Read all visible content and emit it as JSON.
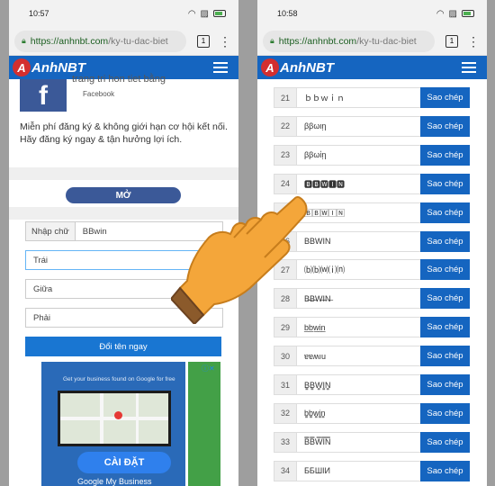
{
  "left": {
    "time": "10:57",
    "url_host": "https://anhnbt.com",
    "url_path": "/ky-tu-dac-biet",
    "tab_count": "1",
    "logo": "AnhNBT",
    "logo_letter": "A",
    "fb_title": "trang tri hon tiet bằng",
    "fb_subtitle": "Facebook",
    "promo_text": "Miễn phí đăng ký & không giới hạn cơ hội kết nối. Hãy đăng ký ngay & tận hưởng lợi ích.",
    "open_button": "MỞ",
    "input_label": "Nhập chữ",
    "input_value": "BBwin",
    "align_left": "Trái",
    "align_center": "Giữa",
    "align_right": "Phải",
    "rename_button": "Đổi tên ngay",
    "ad_headline": "Get your business found on Google for free",
    "ad_install": "CÀI ĐẶT",
    "ad_footer": "Google My Business"
  },
  "right": {
    "time": "10:58",
    "url_host": "https://anhnbt.com",
    "url_path": "/ky-tu-dac-biet",
    "tab_count": "1",
    "logo": "AnhNBT",
    "logo_letter": "A",
    "copy_label": "Sao chép",
    "rows": [
      {
        "num": "21",
        "text": "ｂｂｗｉｎ"
      },
      {
        "num": "22",
        "text": "ββωιῃ"
      },
      {
        "num": "23",
        "text": "ββωἰῃ"
      },
      {
        "num": "24",
        "text": "🅱🅱🆆🅸🅽"
      },
      {
        "num": "25",
        "text": "🄱🄱🅆🄸🄽"
      },
      {
        "num": "26",
        "text": "BBWIN"
      },
      {
        "num": "27",
        "text": "⒝⒝⒲⒤⒩"
      },
      {
        "num": "28",
        "text": "B̶B̶W̶I̶N̶"
      },
      {
        "num": "29",
        "text": "b̲b̲w̲i̲n̲"
      },
      {
        "num": "30",
        "text": "ɐɐʍıu"
      },
      {
        "num": "31",
        "text": "B̳B̳W̳I̳N̳"
      },
      {
        "num": "32",
        "text": "b̳b̳w̳i̳n̳"
      },
      {
        "num": "33",
        "text": "B̿B̿W̿I̿N̿"
      },
      {
        "num": "34",
        "text": "ББШIИ"
      }
    ]
  }
}
